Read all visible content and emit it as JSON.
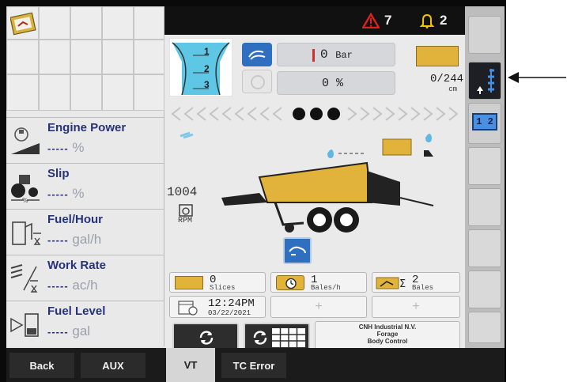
{
  "status": {
    "alarm_count": "7",
    "notification_count": "2",
    "alarm_color": "#e02020",
    "bell_color": "#f2c200"
  },
  "left_panel": {
    "metrics": [
      {
        "label": "Engine Power",
        "value": "-----",
        "unit": "%"
      },
      {
        "label": "Slip",
        "value": "-----",
        "unit": "%"
      },
      {
        "label": "Fuel/Hour",
        "value": "-----",
        "unit": "gal/h"
      },
      {
        "label": "Work Rate",
        "value": "-----",
        "unit": "ac/h"
      },
      {
        "label": "Fuel Level",
        "value": "-----",
        "unit": "gal"
      }
    ]
  },
  "center": {
    "gears": [
      "1",
      "2",
      "3"
    ],
    "pressure": {
      "value": "0",
      "unit": "Bar"
    },
    "percent": {
      "value": "0",
      "unit": "%"
    },
    "bale_length": {
      "value": "0/244",
      "unit": "cm"
    },
    "bale_count_right": "0",
    "rpm": {
      "value": "1004",
      "label": "RPM"
    },
    "stats": [
      {
        "value": "0",
        "unit": "Slices"
      },
      {
        "value": "1",
        "unit": "Bales/h"
      },
      {
        "value": "2",
        "unit": "Bales"
      }
    ],
    "datetime": {
      "time": "12:24PM",
      "date": "03/22/2021"
    },
    "empty_slot": "+",
    "vendor": {
      "line1": "CNH Industrial N.V.",
      "line2": "Forage",
      "line3": "Body Control"
    }
  },
  "tabs": [
    {
      "label": "Back"
    },
    {
      "label": "AUX"
    },
    {
      "label": "VT"
    },
    {
      "label": "TC Error"
    }
  ],
  "right_strip": {
    "split_label": "1 2"
  },
  "accent_color": "#2f6fc0",
  "bale_color": "#e2b33a"
}
